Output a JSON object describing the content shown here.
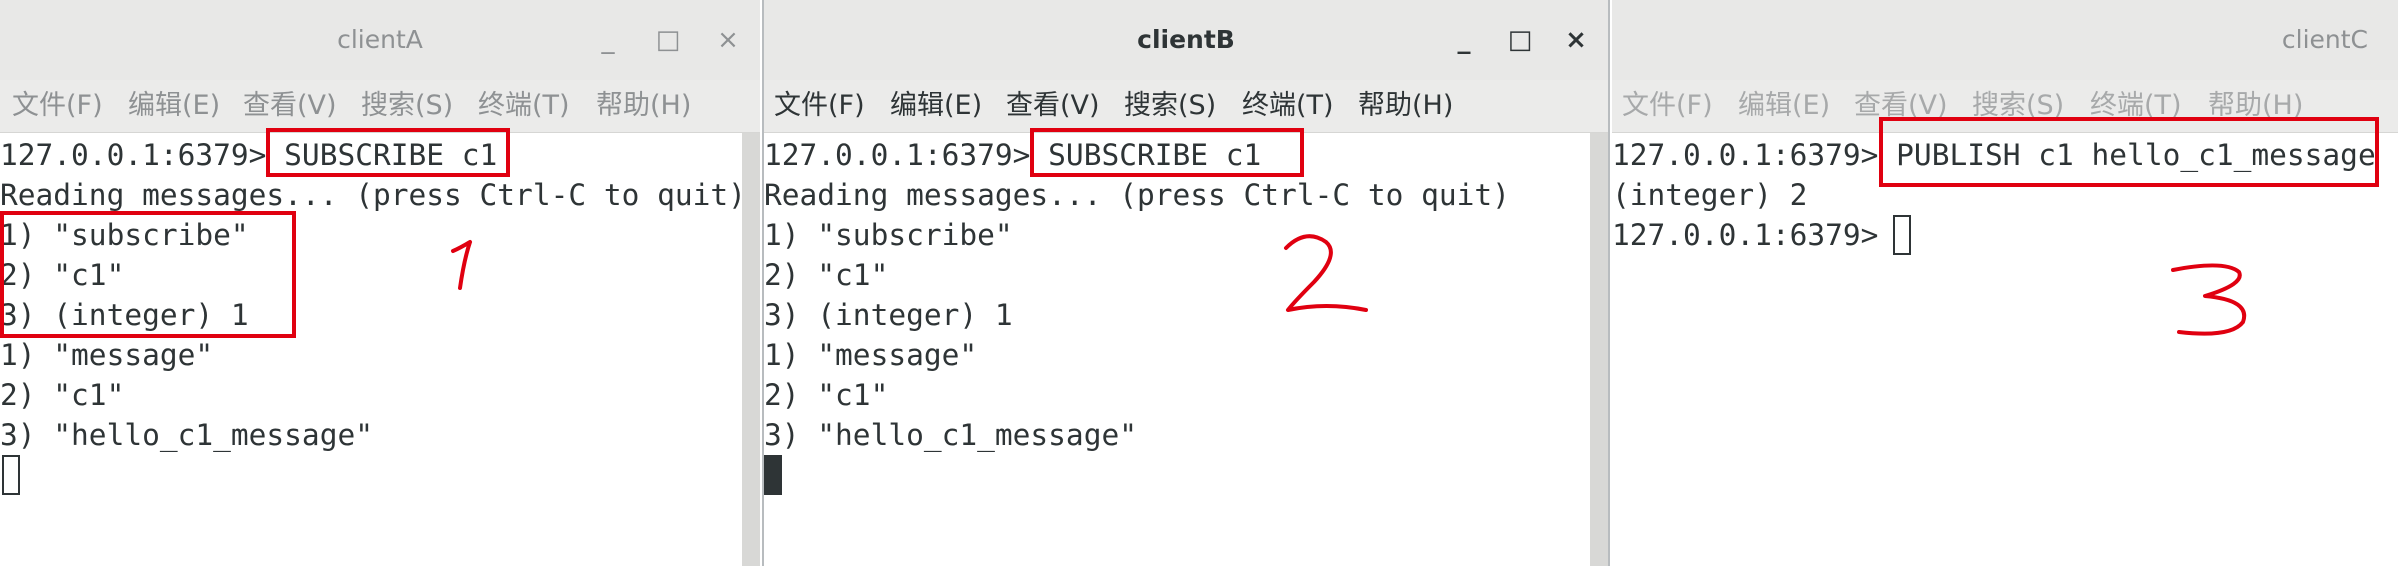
{
  "menu": [
    "文件(F)",
    "编辑(E)",
    "查看(V)",
    "搜索(S)",
    "终端(T)",
    "帮助(H)"
  ],
  "window_controls": {
    "minimize": "_",
    "maximize": "□",
    "close": "×"
  },
  "clientA": {
    "title": "clientA",
    "lines": [
      "127.0.0.1:6379> SUBSCRIBE c1",
      "Reading messages... (press Ctrl-C to quit)",
      "1) \"subscribe\"",
      "2) \"c1\"",
      "3) (integer) 1",
      "1) \"message\"",
      "2) \"c1\"",
      "3) \"hello_c1_message\""
    ]
  },
  "clientB": {
    "title": "clientB",
    "lines": [
      "127.0.0.1:6379> SUBSCRIBE c1",
      "Reading messages... (press Ctrl-C to quit)",
      "1) \"subscribe\"",
      "2) \"c1\"",
      "3) (integer) 1",
      "1) \"message\"",
      "2) \"c1\"",
      "3) \"hello_c1_message\""
    ]
  },
  "clientC": {
    "title": "clientC",
    "lines": [
      "127.0.0.1:6379> PUBLISH c1 hello_c1_message",
      "(integer) 2",
      "127.0.0.1:6379> "
    ]
  },
  "annotations": [
    "1",
    "2",
    "3"
  ],
  "colors": {
    "annotation_red": "#e00010",
    "terminal_text": "#2e3436"
  }
}
